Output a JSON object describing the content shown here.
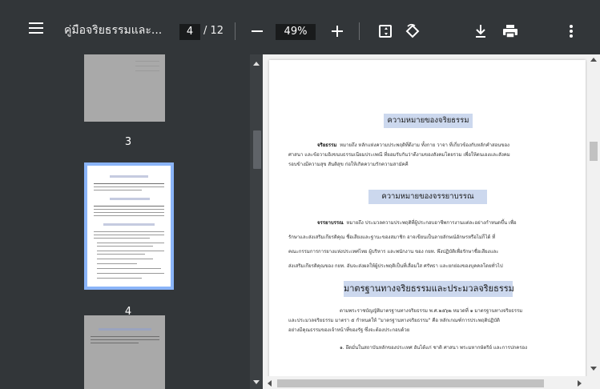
{
  "toolbar": {
    "doc_title": "คู่มือจริยธรรมและ...",
    "current_page": "4",
    "page_total": "/ 12",
    "zoom": "49%"
  },
  "thumbnails": [
    {
      "label": "3"
    },
    {
      "label": "4"
    }
  ],
  "page": {
    "title1": "ความหมายของจริยธรรม",
    "para1_lead": "จริยธรรม",
    "para1_l1": "หมายถึง หลักแห่งความประพฤติที่ดีงาม ทั้งกาย วาจา ที่เกี่ยวข้องกับหลักคำสอนของ",
    "para1_l2": "ศาสนา และข้อวามอิงขนบธรรมเนียมประเพณี ที่ยอมรับกันว่าดีงามของสังคมโดยรวม เพื่อให้ตนเองและสังคม",
    "para1_l3": "รอบข้างมีความสุข สันติสุข ก่อให้เกิดความรักความสามัคคี",
    "title2": "ความหมายของจรรยาบรรณ",
    "para2_lead": "จรรยาบรรณ",
    "para2_l1": "หมายถึง ประมวลความประพฤติที่ผู้ประกอบอาชีพการงานแต่ละอย่างกำหนดขึ้น เพื่อ",
    "para2_l2": "รักษาและส่งเสริมเกียรติคุณ ชื่อเสียงและฐานะของสมาชิก อาจเขียนเป็นลายลักษณ์อักษรหรือไม่ก็ได้ ที่",
    "para2_l3": "คณะกรรมการการยางแห่งประเทศไทย ผู้บริหาร และพนักงาน ของ กยท. พึงปฏิบัติเพื่อรักษาชื่อเสียงและ",
    "para2_l4": "ส่งเสริมเกียรติคุณของ กยท. อันจะส่งผลให้ผู้ประพฤติเป็นที่เลื่อมใส ศรัทธา และยกย่องของบุคคลโดยทั่วไป",
    "title3": "มาตรฐานทางจริยธรรมและประมวลจริยธรรม",
    "para3_l1": "ตามพระราชบัญญัติมาตรฐานทางจริยธรรม พ.ศ.๒๕๖๒ หมวดที่ ๑ มาตรฐานทางจริยธรรม",
    "para3_l2": "และประมวลจริยธรรม มาตรา ๕ กำหนดให้ \"มาตรฐานทางจริยธรรม\" คือ หลักเกณฑ์การประพฤติปฏิบัติ",
    "para3_l3": "อย่างมีคุณธรรมของเจ้าหน้าที่ของรัฐ ซึ่งจะต้องประกอบด้วย",
    "para3_l4": "๑. ยึดมั่นในสถาบันหลักของประเทศ อันได้แก่ ชาติ ศาสนา พระมหากษัตริย์ และการปกครอง"
  }
}
